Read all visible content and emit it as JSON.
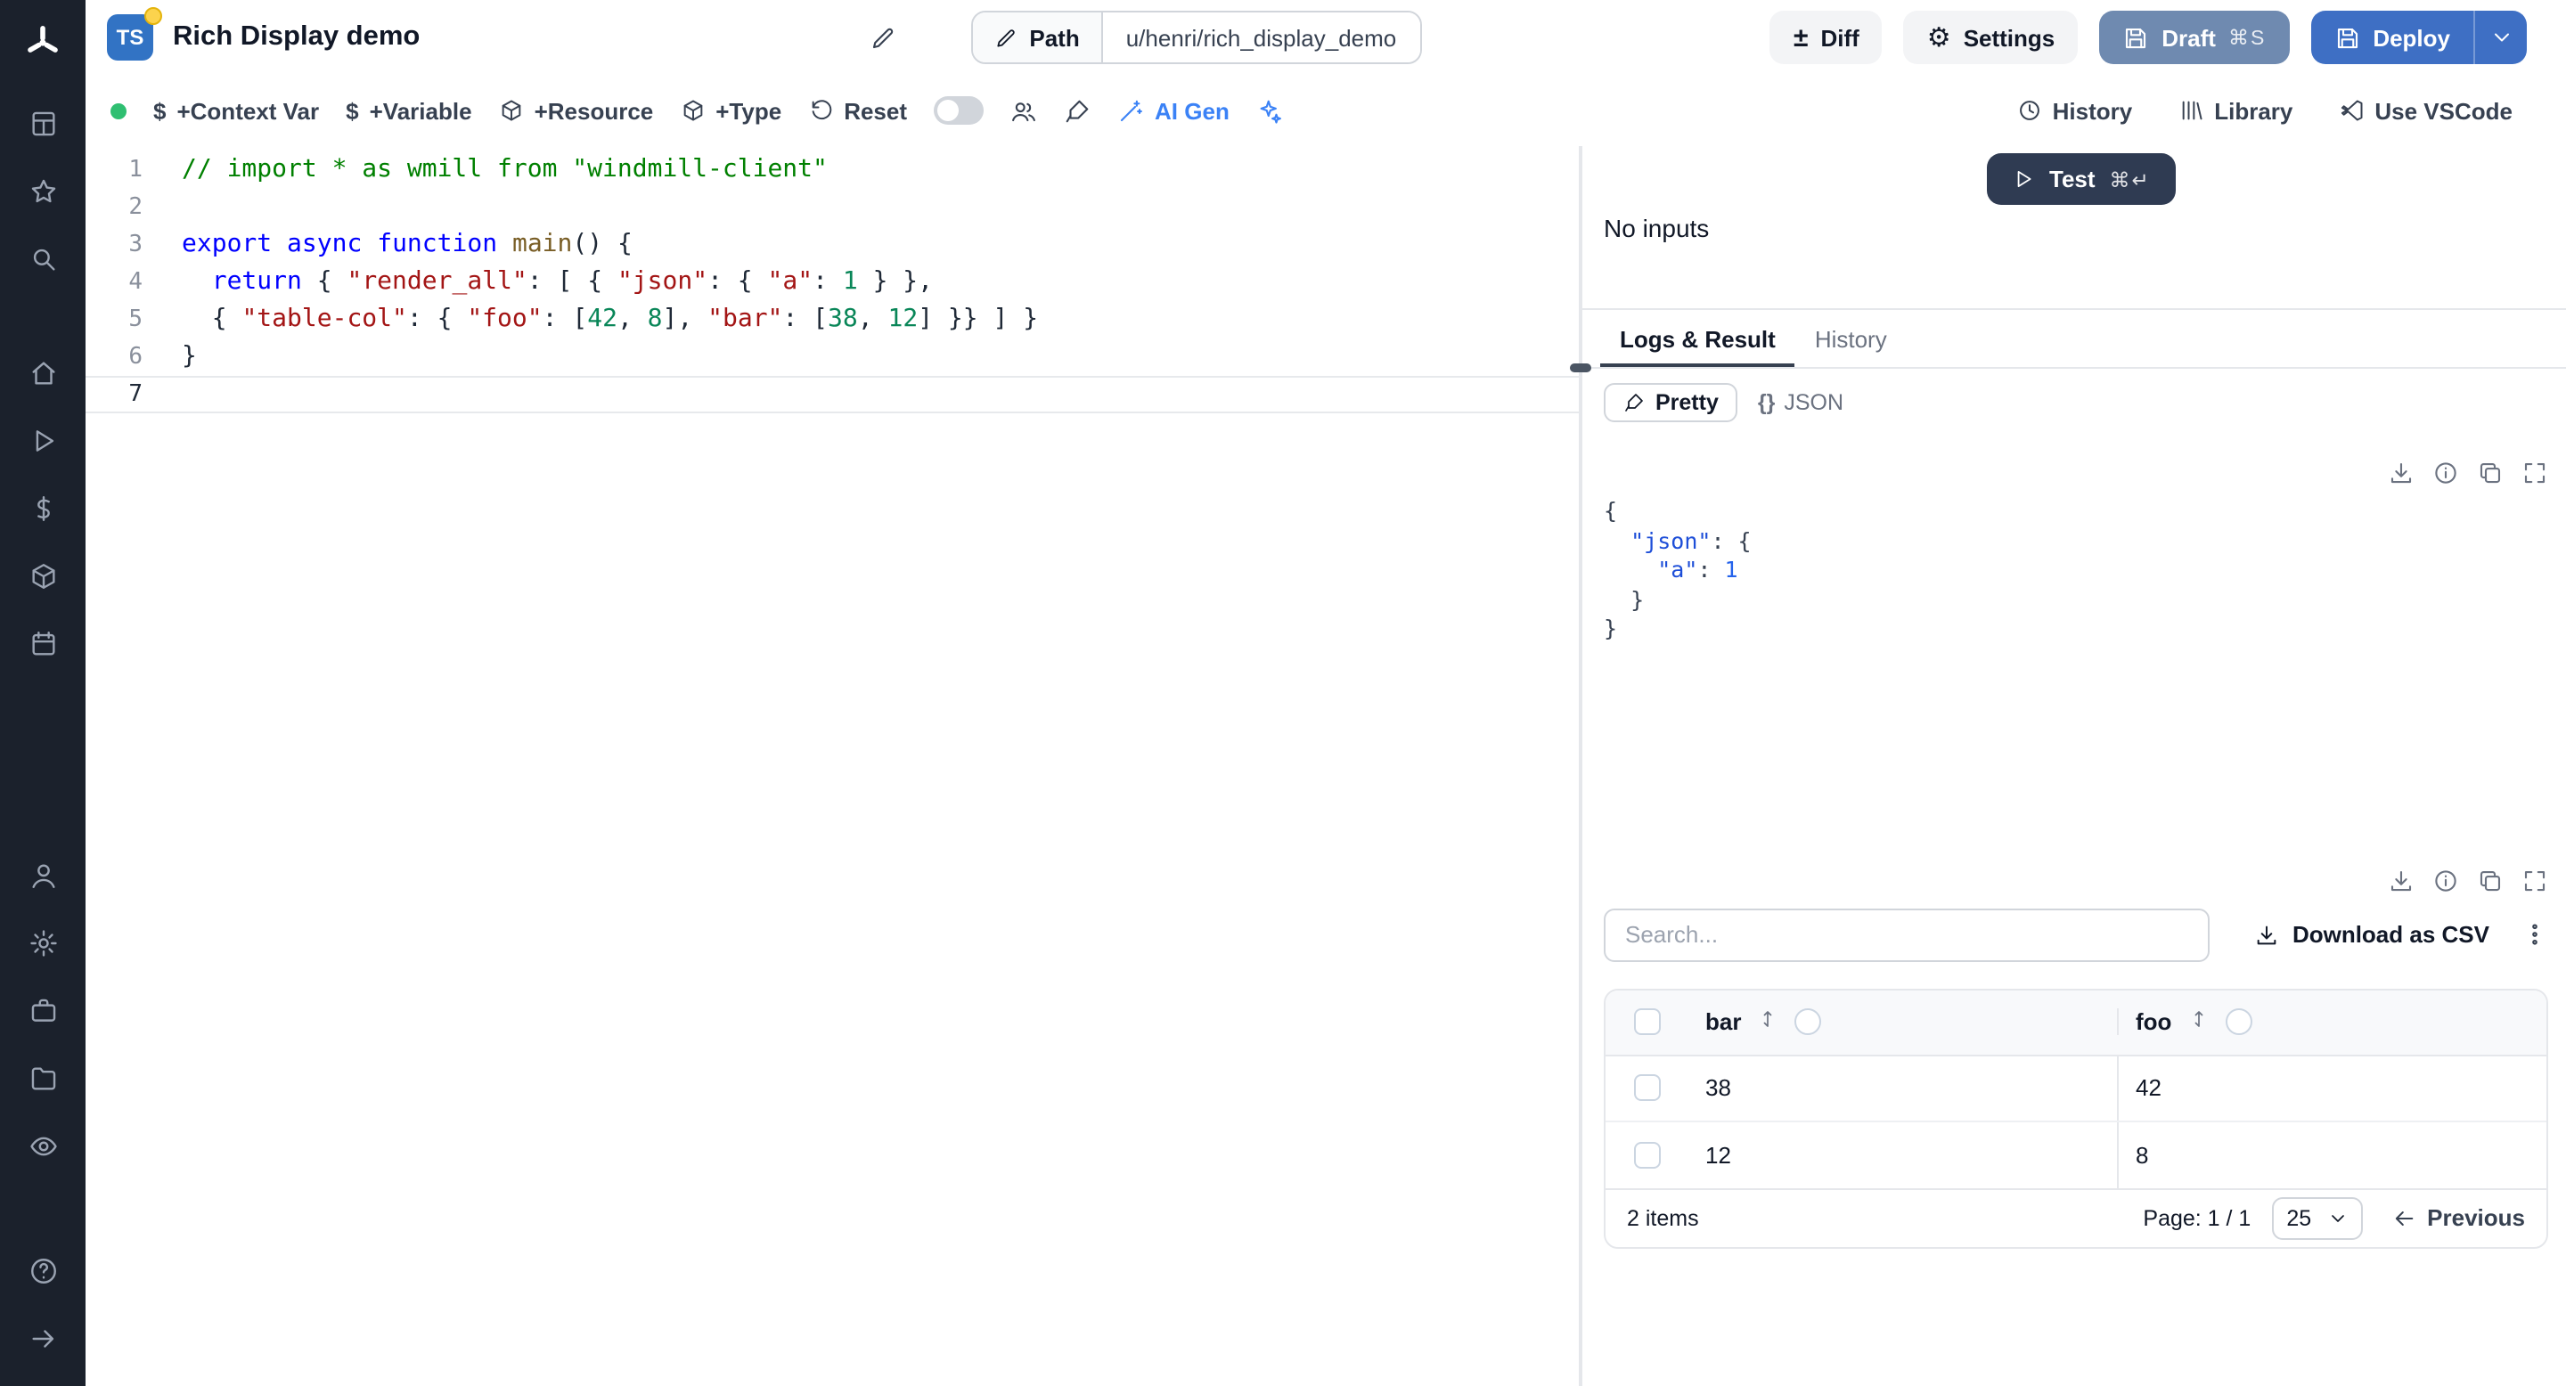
{
  "colors": {
    "sidebar_bg": "#1b212c",
    "deploy_blue": "#3e6fc4",
    "draft_blue": "#6f8ab0",
    "test_navy": "#2f3b52",
    "ts_badge_blue": "#3273c4",
    "status_green": "#2fbf71",
    "accent_blue": "#3b82f6"
  },
  "sidebar": {
    "groups": [
      {
        "items": [
          {
            "name": "apps-icon",
            "shape": "grid"
          },
          {
            "name": "favorites-icon",
            "shape": "star"
          },
          {
            "name": "search-icon",
            "shape": "search"
          }
        ]
      },
      {
        "items": [
          {
            "name": "home-icon",
            "shape": "home"
          },
          {
            "name": "runs-icon",
            "shape": "play"
          },
          {
            "name": "variables-icon",
            "shape": "dollar"
          },
          {
            "name": "resources-icon",
            "shape": "cube"
          },
          {
            "name": "schedules-icon",
            "shape": "calendar"
          }
        ]
      },
      {
        "items": [
          {
            "name": "users-icon",
            "shape": "user"
          },
          {
            "name": "settings-icon",
            "shape": "gear"
          },
          {
            "name": "workers-icon",
            "shape": "briefcase"
          },
          {
            "name": "folders-icon",
            "shape": "folder"
          },
          {
            "name": "audit-logs-icon",
            "shape": "eye"
          }
        ]
      },
      {
        "items": [
          {
            "name": "help-icon",
            "shape": "help"
          },
          {
            "name": "collapse-sidebar-icon",
            "shape": "arrow-right"
          }
        ]
      }
    ]
  },
  "header": {
    "lang_badge": "TS",
    "title": "Rich Display demo",
    "path_label": "Path",
    "path_value": "u/henri/rich_display_demo",
    "diff_label": "Diff",
    "diff_glyph": "±",
    "settings_label": "Settings",
    "settings_glyph": "⚙",
    "draft_label": "Draft",
    "draft_kbd": "⌘S",
    "deploy_label": "Deploy"
  },
  "toolbar": {
    "context_var": "+Context Var",
    "variable": "+Variable",
    "resource": "+Resource",
    "type": "+Type",
    "reset": "Reset",
    "dollar_glyph": "$",
    "ai_gen": "AI Gen",
    "history": "History",
    "library": "Library",
    "vscode": "Use VSCode"
  },
  "editor": {
    "lines": [
      {
        "n": "1",
        "tokens": [
          {
            "c": "cmt",
            "t": "// import * as wmill from \"windmill-client\""
          }
        ]
      },
      {
        "n": "2",
        "tokens": []
      },
      {
        "n": "3",
        "tokens": [
          {
            "c": "kw",
            "t": "export"
          },
          {
            "c": "pl",
            "t": " "
          },
          {
            "c": "kw",
            "t": "async"
          },
          {
            "c": "pl",
            "t": " "
          },
          {
            "c": "kw",
            "t": "function"
          },
          {
            "c": "pl",
            "t": " "
          },
          {
            "c": "fn",
            "t": "main"
          },
          {
            "c": "pl",
            "t": "() {"
          }
        ]
      },
      {
        "n": "4",
        "tokens": [
          {
            "c": "pl",
            "t": "  "
          },
          {
            "c": "kw",
            "t": "return"
          },
          {
            "c": "pl",
            "t": " { "
          },
          {
            "c": "str",
            "t": "\"render_all\""
          },
          {
            "c": "pl",
            "t": ": [ { "
          },
          {
            "c": "str",
            "t": "\"json\""
          },
          {
            "c": "pl",
            "t": ": { "
          },
          {
            "c": "str",
            "t": "\"a\""
          },
          {
            "c": "pl",
            "t": ": "
          },
          {
            "c": "num",
            "t": "1"
          },
          {
            "c": "pl",
            "t": " } },"
          }
        ]
      },
      {
        "n": "5",
        "tokens": [
          {
            "c": "pl",
            "t": "  { "
          },
          {
            "c": "str",
            "t": "\"table-col\""
          },
          {
            "c": "pl",
            "t": ": { "
          },
          {
            "c": "str",
            "t": "\"foo\""
          },
          {
            "c": "pl",
            "t": ": ["
          },
          {
            "c": "num",
            "t": "42"
          },
          {
            "c": "pl",
            "t": ", "
          },
          {
            "c": "num",
            "t": "8"
          },
          {
            "c": "pl",
            "t": "], "
          },
          {
            "c": "str",
            "t": "\"bar\""
          },
          {
            "c": "pl",
            "t": ": ["
          },
          {
            "c": "num",
            "t": "38"
          },
          {
            "c": "pl",
            "t": ", "
          },
          {
            "c": "num",
            "t": "12"
          },
          {
            "c": "pl",
            "t": "] }} ] }"
          }
        ]
      },
      {
        "n": "6",
        "tokens": [
          {
            "c": "pl",
            "t": "}"
          }
        ]
      },
      {
        "n": "7",
        "tokens": [],
        "current": true
      }
    ]
  },
  "runpanel": {
    "test_label": "Test",
    "test_kbd": "⌘↵",
    "no_inputs": "No inputs",
    "tab_logs": "Logs & Result",
    "tab_history": "History",
    "pretty_label": "Pretty",
    "json_label": "JSON",
    "json_glyph": "{}"
  },
  "result_json": {
    "lines": [
      [
        {
          "c": "pn",
          "t": "{"
        }
      ],
      [
        {
          "c": "pn",
          "t": "  "
        },
        {
          "c": "key",
          "t": "\"json\""
        },
        {
          "c": "pn",
          "t": ": {"
        }
      ],
      [
        {
          "c": "pn",
          "t": "    "
        },
        {
          "c": "key",
          "t": "\"a\""
        },
        {
          "c": "pn",
          "t": ": "
        },
        {
          "c": "jnum",
          "t": "1"
        }
      ],
      [
        {
          "c": "pn",
          "t": "  }"
        }
      ],
      [
        {
          "c": "pn",
          "t": "}"
        }
      ]
    ]
  },
  "table_section": {
    "search_placeholder": "Search...",
    "csv_label": "Download as CSV"
  },
  "table": {
    "columns": [
      {
        "label": "bar"
      },
      {
        "label": "foo"
      }
    ],
    "rows": [
      [
        "38",
        "42"
      ],
      [
        "12",
        "8"
      ]
    ],
    "items_label": "2 items",
    "page_text": "Page: 1 / 1",
    "page_size": "25",
    "previous_label": "Previous"
  }
}
